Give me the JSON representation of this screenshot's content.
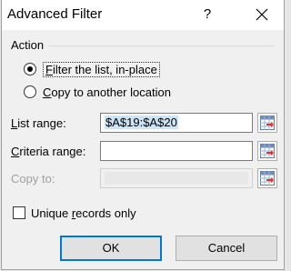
{
  "dialog": {
    "title": "Advanced Filter",
    "help_label": "?",
    "close_icon": "close-icon"
  },
  "action": {
    "group_label": "Action",
    "options": [
      {
        "label_accel": "F",
        "label_rest": "ilter the list, in-place",
        "selected": true
      },
      {
        "label_accel": "C",
        "label_rest": "opy to another location",
        "selected": false
      }
    ]
  },
  "fields": {
    "list_range": {
      "label_accel": "L",
      "label_rest": "ist range:",
      "value": "$A$19:$A$20"
    },
    "criteria_range": {
      "label_accel": "C",
      "label_rest": "riteria range:",
      "value": ""
    },
    "copy_to": {
      "label": "Copy to:",
      "value": "",
      "disabled": true
    }
  },
  "unique_records": {
    "label_before": "Unique ",
    "label_accel": "r",
    "label_after": "ecords only",
    "checked": false
  },
  "buttons": {
    "ok": "OK",
    "cancel": "Cancel"
  },
  "colors": {
    "accent": "#0078d7",
    "selection": "#cce4f7",
    "dialog_bg": "#f0f0f0"
  }
}
